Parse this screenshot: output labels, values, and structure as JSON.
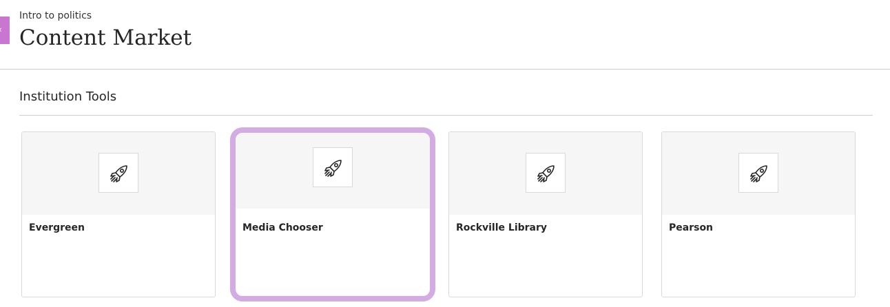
{
  "header": {
    "course_name": "Intro to politics",
    "page_title": "Content Market",
    "back_icon": "chevron-left-icon",
    "accent_color": "#c975d2"
  },
  "section": {
    "title": "Institution Tools"
  },
  "tools": [
    {
      "name": "Evergreen",
      "icon": "rocket-icon"
    },
    {
      "name": "Media Chooser",
      "icon": "rocket-icon",
      "focused": true,
      "focus_color": "#d3ace3"
    },
    {
      "name": "Rockville Library",
      "icon": "rocket-icon"
    },
    {
      "name": "Pearson",
      "icon": "rocket-icon"
    }
  ]
}
